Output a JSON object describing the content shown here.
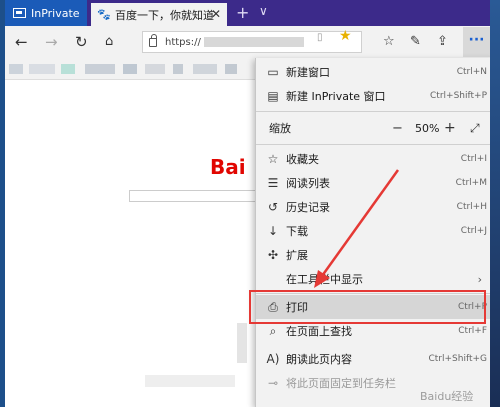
{
  "tabs": {
    "inprivate_label": "InPrivate",
    "active_title": "百度一下，你就知道",
    "close": "✕",
    "new_tab": "+",
    "tab_list": "∨"
  },
  "nav": {
    "url": "https://",
    "back_icon": "arrow-left-icon",
    "forward_icon": "arrow-right-icon",
    "refresh_icon": "refresh-icon",
    "home_icon": "home-icon",
    "more": "···"
  },
  "page": {
    "logo": "Bai"
  },
  "menu": {
    "new_window": {
      "label": "新建窗口",
      "key": "Ctrl+N"
    },
    "new_inprivate": {
      "label": "新建 InPrivate 窗口",
      "key": "Ctrl+Shift+P"
    },
    "zoom": {
      "label": "缩放",
      "value": "50%",
      "minus": "−",
      "plus": "+"
    },
    "favorites": {
      "label": "收藏夹",
      "key": "Ctrl+I"
    },
    "reading_list": {
      "label": "阅读列表",
      "key": "Ctrl+M"
    },
    "history": {
      "label": "历史记录",
      "key": "Ctrl+H"
    },
    "downloads": {
      "label": "下载",
      "key": "Ctrl+J"
    },
    "extensions": {
      "label": "扩展"
    },
    "show_in_toolbar": {
      "label": "在工具栏中显示"
    },
    "print": {
      "label": "打印",
      "key": "Ctrl+P"
    },
    "find": {
      "label": "在页面上查找",
      "key": "Ctrl+F"
    },
    "read_aloud": {
      "label": "朗读此页内容",
      "key": "Ctrl+Shift+G"
    },
    "pin": {
      "label": "将此页面固定到任务栏"
    }
  },
  "watermark": "Baidu经验",
  "colors": {
    "annotation": "#e53935",
    "inprivate_tab": "#1b5bb8",
    "titlebar": "#3c2a8a"
  }
}
